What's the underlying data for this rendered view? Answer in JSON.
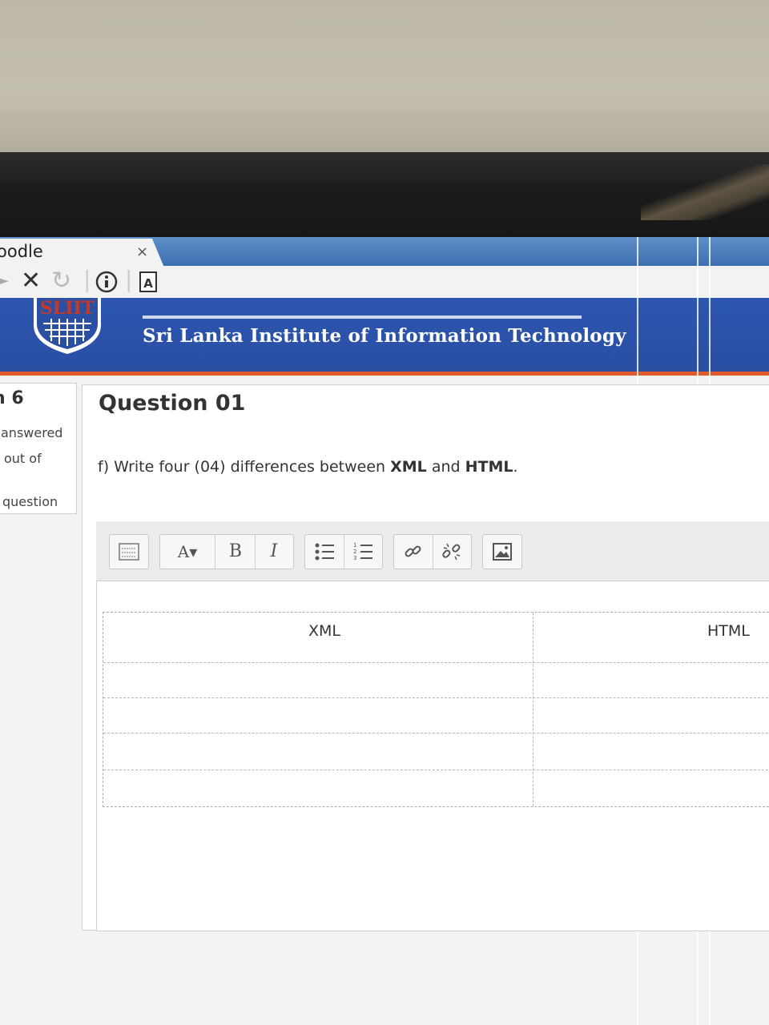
{
  "browser": {
    "tab_title": "oodle",
    "tab_close": "×",
    "nav": [
      "back-arrow",
      "stop-icon",
      "reload-icon",
      "info-icon",
      "reader-icon"
    ]
  },
  "header": {
    "logo_text": "SLIIT",
    "title": "Sri Lanka Institute of Information Technology"
  },
  "question_info": {
    "number": "n 6",
    "status_line1": "answered",
    "status_line2": "out of",
    "status_line3": "question"
  },
  "question": {
    "title": "Question 01",
    "text_prefix": "f) Write four (04) differences between ",
    "term1": "XML",
    "text_mid": " and ",
    "term2": "HTML",
    "text_suffix": "."
  },
  "editor": {
    "toolbar": [
      "show-more-icon",
      "font-style-icon",
      "bold",
      "italic",
      "unordered-list-icon",
      "ordered-list-icon",
      "link-icon",
      "unlink-icon",
      "image-icon"
    ],
    "bold_label": "B",
    "italic_label": "I",
    "font_label": "A",
    "table": {
      "headers": [
        "XML",
        "HTML"
      ],
      "rows": 4
    }
  }
}
